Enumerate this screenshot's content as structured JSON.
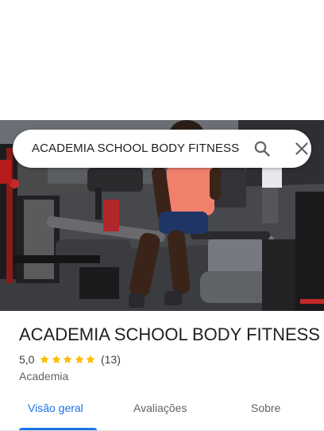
{
  "search": {
    "query": "ACADEMIA SCHOOL BODY FITNESS",
    "icons": {
      "search": "search-icon",
      "close": "close-icon"
    }
  },
  "place": {
    "name": "ACADEMIA SCHOOL BODY FITNESS",
    "rating": "5,0",
    "stars": 5,
    "reviews_count": "(13)",
    "category": "Academia"
  },
  "tabs": [
    {
      "label": "Visão geral",
      "active": true
    },
    {
      "label": "Avaliações",
      "active": false
    },
    {
      "label": "Sobre",
      "active": false
    }
  ],
  "colors": {
    "accent": "#1a73e8",
    "star": "#fbbc04",
    "text_primary": "#202124",
    "text_secondary": "#5f6368"
  }
}
